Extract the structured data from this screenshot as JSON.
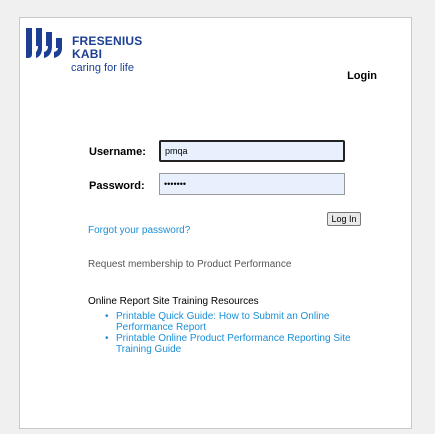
{
  "brand": {
    "line1": "FRESENIUS",
    "line2": "KABI",
    "tagline": "caring for life",
    "color": "#1c3f94"
  },
  "login": {
    "title": "Login",
    "username_label": "Username:",
    "username_value": "pmqa",
    "password_label": "Password:",
    "password_value": "•••••••",
    "submit_label": "Log In"
  },
  "links": {
    "forgot": "Forgot your password?",
    "request": "Request membership to Product Performance",
    "color": "#1a8fd8"
  },
  "resources": {
    "title": "Online Report Site Training Resources",
    "items": [
      {
        "label": "Printable Quick Guide: How to Submit an Online Performance Report"
      },
      {
        "label": "Printable Online Product Performance Reporting Site Training Guide"
      }
    ]
  }
}
